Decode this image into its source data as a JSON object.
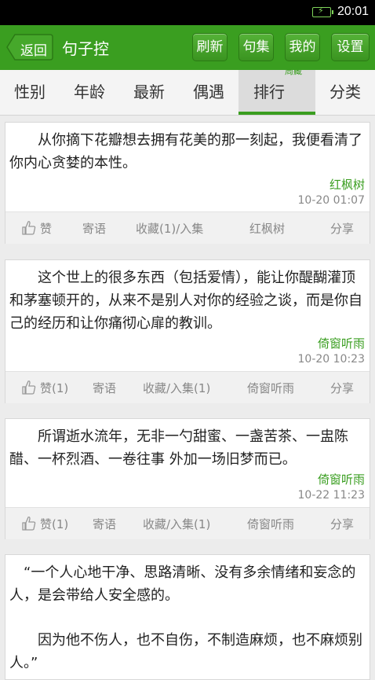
{
  "status": {
    "time": "20:01"
  },
  "header": {
    "back_label": "返回",
    "title": "句子控",
    "buttons": [
      "刷新",
      "句集",
      "我的",
      "设置"
    ]
  },
  "tabs": [
    {
      "label": "性别"
    },
    {
      "label": "年龄"
    },
    {
      "label": "最新"
    },
    {
      "label": "偶遇"
    },
    {
      "label": "排行",
      "badge": "周藏",
      "active": true
    },
    {
      "label": "分类"
    }
  ],
  "colors": {
    "accent": "#3a9e20"
  },
  "posts": [
    {
      "text": "从你摘下花瓣想去拥有花美的那一刻起，我便看清了你内心贪婪的本性。",
      "author": "红枫树",
      "time": "10-20 01:07",
      "like": "赞",
      "reply": "寄语",
      "collect": "收藏(1)/入集",
      "user": "红枫树",
      "share": "分享"
    },
    {
      "text": "这个世上的很多东西（包括爱情），能让你醍醐灌顶和茅塞顿开的，从来不是别人对你的经验之谈，而是你自己的经历和让你痛彻心扉的教训。",
      "author": "倚窗听雨",
      "time": "10-20 10:23",
      "like": "赞(1)",
      "reply": "寄语",
      "collect": "收藏/入集(1)",
      "user": "倚窗听雨",
      "share": "分享"
    },
    {
      "text": "所谓逝水流年，无非一勺甜蜜、一盏苦茶、一盅陈醋、一杯烈酒、一卷往事 外加一场旧梦而已。",
      "author": "倚窗听雨",
      "time": "10-22 11:23",
      "like": "赞(1)",
      "reply": "寄语",
      "collect": "收藏/入集(1)",
      "user": "倚窗听雨",
      "share": "分享"
    },
    {
      "text": "“一个人心地干净、思路清晰、没有多余情绪和妄念的人，是会带给人安全感的。",
      "text2": "因为他不伤人，也不自伤，不制造麻烦，也不麻烦别人。”"
    }
  ]
}
